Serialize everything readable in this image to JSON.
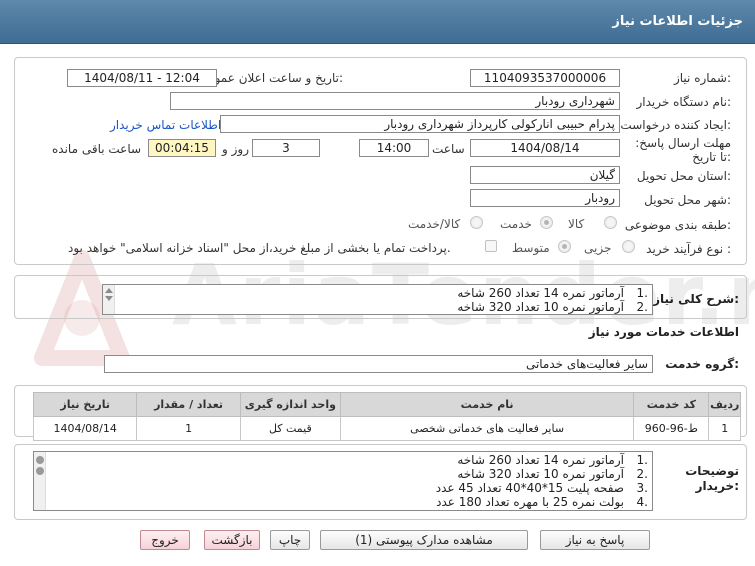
{
  "header": {
    "title": "جزئیات اطلاعات نیاز"
  },
  "watermark": {
    "text": "AriaTender.net"
  },
  "form": {
    "need_number_label": "شماره نیاز:",
    "need_number": "1104093537000006",
    "announce_label": "تاریخ و ساعت اعلان عمومی:",
    "announce_value": "1404/08/11 - 12:04",
    "buyer_org_label": "نام دستگاه خریدار:",
    "buyer_org": "شهرداری رودبار",
    "creator_label": "ایجاد کننده درخواست:",
    "creator": "پدرام حبیبی انارکولی کارپرداز شهرداری رودبار",
    "contact_link": "اطلاعات تماس خریدار",
    "deadline_label": "مهلت ارسال پاسخ: تا تاریخ:",
    "deadline_date": "1404/08/14",
    "time_label": "ساعت",
    "deadline_time": "14:00",
    "days_value": "3",
    "days_label": "روز و",
    "remaining_time": "00:04:15",
    "remaining_label": "ساعت باقی مانده",
    "province_label": "استان محل تحویل:",
    "province": "گیلان",
    "city_label": "شهر محل تحویل:",
    "city": "رودبار",
    "category_label": "طبقه بندی موضوعی:",
    "category_options": [
      "کالا",
      "خدمت",
      "کالا/خدمت"
    ],
    "category_selected": "خدمت",
    "process_label": "نوع فرآیند خرید :",
    "process_options": [
      "جزیی",
      "متوسط"
    ],
    "process_selected": "متوسط",
    "payment_note": "پرداخت تمام یا بخشی از مبلغ خرید،از محل \"اسناد خزانه اسلامی\" خواهد بود."
  },
  "summary": {
    "label": "شرح کلی نیاز:",
    "items": [
      {
        "num": "1.",
        "text": "آرماتور نمره 14 تعداد 260 شاخه"
      },
      {
        "num": "2.",
        "text": "آرماتور نمره 10 تعداد 320 شاخه"
      }
    ]
  },
  "services": {
    "section_title": "اطلاعات خدمات مورد نیاز",
    "group_label": "گروه خدمت:",
    "group_value": "سایر فعالیت‌های خدماتی",
    "table": {
      "headers": [
        "ردیف",
        "کد خدمت",
        "نام خدمت",
        "واحد اندازه گیری",
        "تعداد / مقدار",
        "تاریخ نیاز"
      ],
      "rows": [
        [
          "1",
          "ط-96-960",
          "سایر فعالیت های خدماتی شخصی",
          "قیمت کل",
          "1",
          "1404/08/14"
        ]
      ]
    }
  },
  "buyer_notes": {
    "label": "توضیحات خریدار:",
    "items": [
      {
        "num": "1.",
        "text": "آرماتور نمره 14 تعداد 260 شاخه"
      },
      {
        "num": "2.",
        "text": "آرماتور نمره 10 تعداد 320 شاخه"
      },
      {
        "num": "3.",
        "text": "صفحه پلیت 15*40*40 تعداد 45 عدد"
      },
      {
        "num": "4.",
        "text": "بولت نمره 25 با مهره تعداد 180 عدد"
      }
    ]
  },
  "buttons": {
    "reply": "پاسخ به نیاز",
    "attachments": "مشاهده مدارک پیوستی (1)",
    "print": "چاپ",
    "back": "بازگشت",
    "exit": "خروج"
  }
}
